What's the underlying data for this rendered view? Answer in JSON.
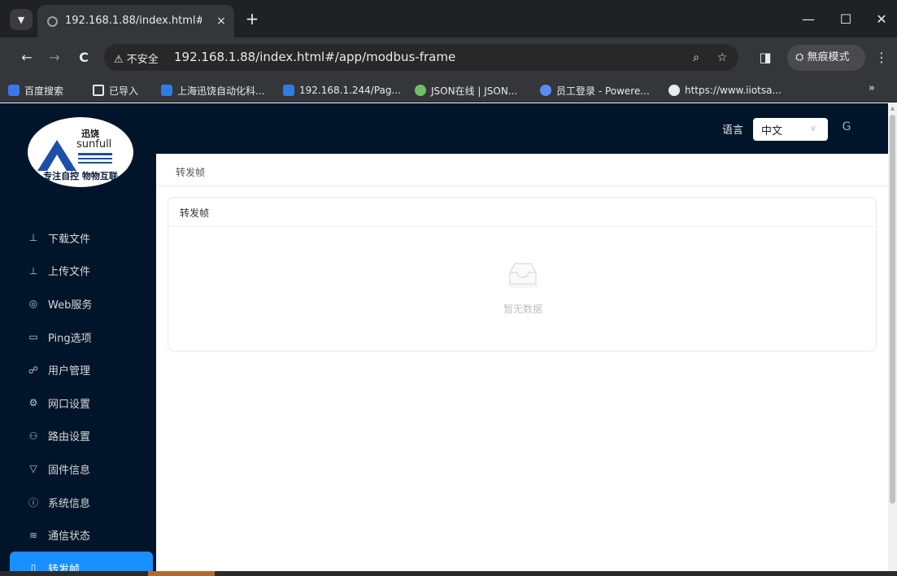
{
  "browser": {
    "tab_title": "192.168.1.88/index.html#/ap",
    "tab_close": "×",
    "new_tab": "+",
    "controls": {
      "minimize": "—",
      "maximize": "☐",
      "close": "✕"
    },
    "back": "←",
    "forward": "→",
    "reload": "C",
    "security_text": "⚠ 不安全",
    "url": "192.168.1.88/index.html#/app/modbus-frame",
    "zoom_icon": "⌕",
    "star_icon": "☆",
    "split_icon": "◨",
    "incognito_label": "無痕模式",
    "incognito_icon": "⛭",
    "menu_icon": "⋮",
    "bookmarks": [
      {
        "label": "百度搜索",
        "color": "#3b78e7"
      },
      {
        "label": "已导入",
        "color": "#e8eaed"
      },
      {
        "label": "上海迅饶自动化科...",
        "color": "#2f7de1"
      },
      {
        "label": "192.168.1.244/Pag...",
        "color": "#2f7de1"
      },
      {
        "label": "JSON在线 | JSON...",
        "color": "#6dbf66"
      },
      {
        "label": "员工登录 - Powere...",
        "color": "#5b8def"
      },
      {
        "label": "https://www.iiotsa...",
        "color": "#e8eaed"
      }
    ],
    "bookmarks_more": "»"
  },
  "logo": {
    "chinese": "迅饶",
    "english": "sunfull",
    "tagline": "专注自控 物物互联"
  },
  "header": {
    "language_label": "语言",
    "language_value": "中文",
    "dropdown_arrow": "∨",
    "refresh_icon": "G"
  },
  "sidebar": {
    "items": [
      {
        "label": "下载文件",
        "icon": "⊥"
      },
      {
        "label": "上传文件",
        "icon": "⊥"
      },
      {
        "label": "Web服务",
        "icon": "◎"
      },
      {
        "label": "Ping选项",
        "icon": "▭"
      },
      {
        "label": "用户管理",
        "icon": "☍"
      },
      {
        "label": "网口设置",
        "icon": "⚙"
      },
      {
        "label": "路由设置",
        "icon": "⚇"
      },
      {
        "label": "固件信息",
        "icon": "▽"
      },
      {
        "label": "系统信息",
        "icon": "ⓘ"
      },
      {
        "label": "通信状态",
        "icon": "≋"
      },
      {
        "label": "转发帧",
        "icon": "▯"
      }
    ]
  },
  "breadcrumb": "转发帧",
  "card": {
    "title": "转发帧",
    "empty_text": "暂无数据"
  },
  "colors": {
    "sidebar_bg": "#001529",
    "active_item": "#1890ff"
  }
}
